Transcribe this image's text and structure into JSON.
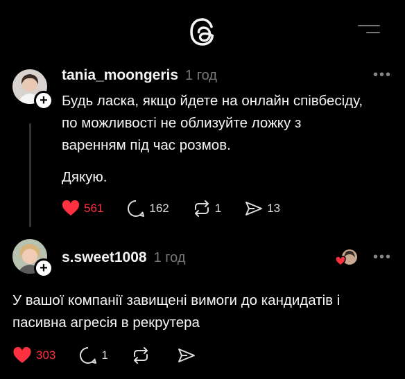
{
  "header": {
    "logo_icon": "threads-logo-icon",
    "menu_icon": "menu-icon"
  },
  "post1": {
    "username": "tania_moongeris",
    "time": "1 год",
    "text_lines": [
      "Будь ласка, якщо йдете на онлайн співбесіду,",
      "по можливості не облизуйте ложку з",
      "варенням під час розмов."
    ],
    "text_line2": "Дякую.",
    "likes": "561",
    "comments": "162",
    "reposts": "1",
    "shares": "13"
  },
  "post2": {
    "username": "s.sweet1008",
    "time": "1 год",
    "text_lines": [
      "У вашої компанії завищені вимоги до кандидатів і",
      "пасивна агресія в рекрутера"
    ],
    "likes": "303",
    "comments": "1"
  },
  "colors": {
    "background": "#000000",
    "like_red": "#ff3040",
    "text": "#f3f5f7",
    "muted": "#777777"
  }
}
